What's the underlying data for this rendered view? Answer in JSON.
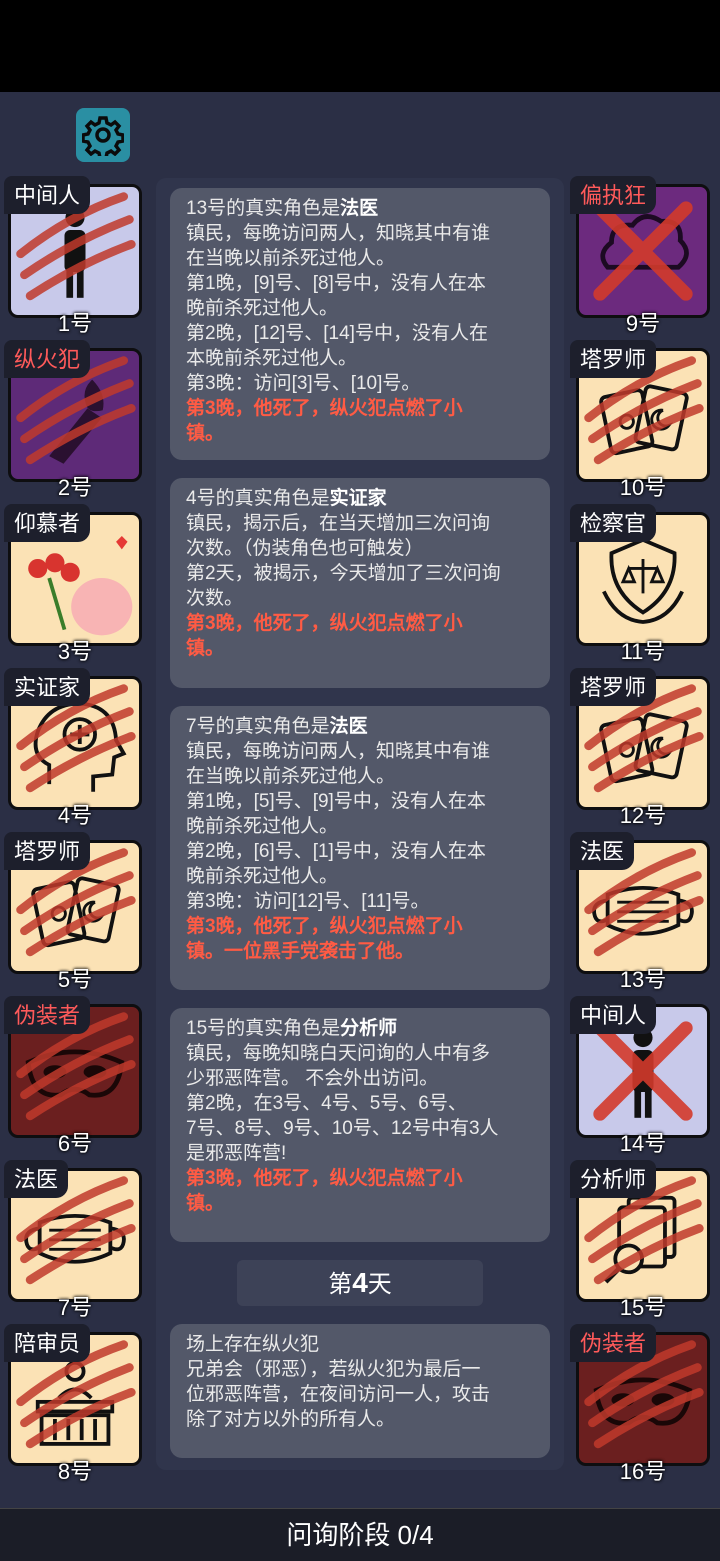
{
  "left_players": [
    {
      "role": "中间人",
      "number": "1号",
      "role_red": false
    },
    {
      "role": "纵火犯",
      "number": "2号",
      "role_red": true
    },
    {
      "role": "仰慕者",
      "number": "3号",
      "role_red": false
    },
    {
      "role": "实证家",
      "number": "4号",
      "role_red": false
    },
    {
      "role": "塔罗师",
      "number": "5号",
      "role_red": false
    },
    {
      "role": "伪装者",
      "number": "6号",
      "role_red": true
    },
    {
      "role": "法医",
      "number": "7号",
      "role_red": false
    },
    {
      "role": "陪审员",
      "number": "8号",
      "role_red": false
    }
  ],
  "right_players": [
    {
      "role": "偏执狂",
      "number": "9号",
      "role_red": true
    },
    {
      "role": "塔罗师",
      "number": "10号",
      "role_red": false
    },
    {
      "role": "检察官",
      "number": "11号",
      "role_red": false
    },
    {
      "role": "塔罗师",
      "number": "12号",
      "role_red": false
    },
    {
      "role": "法医",
      "number": "13号",
      "role_red": false
    },
    {
      "role": "中间人",
      "number": "14号",
      "role_red": false
    },
    {
      "role": "分析师",
      "number": "15号",
      "role_red": false
    },
    {
      "role": "伪装者",
      "number": "16号",
      "role_red": true
    }
  ],
  "messages": [
    {
      "title_prefix": "13号的真实角色是",
      "title_role": "法医",
      "lines": [
        "镇民，每晚访问两人，知晓其中有谁",
        "在当晚以前杀死过他人。",
        "第1晚，[9]号、[8]号中，没有人在本",
        "晚前杀死过他人。",
        "第2晚，[12]号、[14]号中，没有人在",
        "本晚前杀死过他人。",
        "第3晚：访问[3]号、[10]号。"
      ],
      "red_lines": [
        "第3晚，他死了，纵火犯点燃了小",
        "镇。"
      ]
    },
    {
      "title_prefix": "4号的真实角色是",
      "title_role": "实证家",
      "lines": [
        "镇民，揭示后，在当天增加三次问询",
        "次数。（伪装角色也可触发）",
        "第2天，被揭示，今天增加了三次问询",
        "次数。"
      ],
      "red_lines": [
        "第3晚，他死了，纵火犯点燃了小",
        "镇。"
      ]
    },
    {
      "title_prefix": "7号的真实角色是",
      "title_role": "法医",
      "lines": [
        "镇民，每晚访问两人，知晓其中有谁",
        "在当晚以前杀死过他人。",
        "第1晚，[5]号、[9]号中，没有人在本",
        "晚前杀死过他人。",
        "第2晚，[6]号、[1]号中，没有人在本",
        "晚前杀死过他人。",
        "第3晚：访问[12]号、[11]号。"
      ],
      "red_lines": [
        "第3晚，他死了，纵火犯点燃了小",
        "镇。一位黑手党袭击了他。"
      ]
    },
    {
      "title_prefix": "15号的真实角色是",
      "title_role": "分析师",
      "lines": [
        "镇民，每晚知晓白天问询的人中有多",
        "少邪恶阵营。 不会外出访问。",
        "第2晚，在3号、4号、5号、6号、",
        "7号、8号、9号、10号、12号中有3人",
        "是邪恶阵营!"
      ],
      "red_lines": [
        "第3晚，他死了，纵火犯点燃了小",
        "镇。"
      ]
    }
  ],
  "day": {
    "prefix": "第",
    "number": "4",
    "suffix": "天"
  },
  "info": {
    "lines": [
      "场上存在纵火犯",
      "兄弟会（邪恶），若纵火犯为最后一",
      "位邪恶阵营，在夜间访问一人，攻击",
      "除了对方以外的所有人。"
    ]
  },
  "phase": "问询阶段 0/4",
  "icons": {
    "settings": "gear-icon"
  },
  "colors": {
    "background": "#2b2f45",
    "accent_red": "#ff5b44",
    "settings_bg": "#2a8fa3"
  }
}
